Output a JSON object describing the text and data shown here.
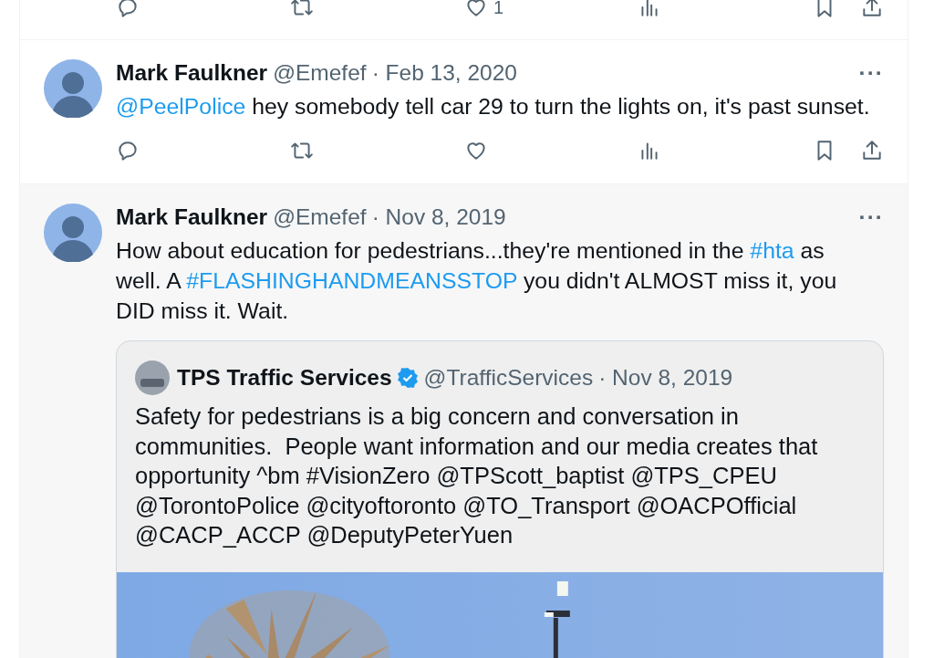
{
  "top_actions": [
    {
      "kind": "reply"
    },
    {
      "kind": "retweet"
    },
    {
      "kind": "like",
      "count": "1"
    },
    {
      "kind": "views"
    },
    {
      "kind": "bookmark"
    },
    {
      "kind": "share"
    }
  ],
  "tweets": [
    {
      "color": "#ffffff",
      "name": "Mark Faulkner",
      "handle": "@Emefef",
      "date": "· Feb 13, 2020",
      "more": "···",
      "body": [
        {
          "kind": "mention",
          "text": "@PeelPolice"
        },
        {
          "kind": "plain",
          "text": " hey somebody tell car 29 to turn the lights on, it's past sunset."
        }
      ],
      "actions": [
        {
          "kind": "reply"
        },
        {
          "kind": "retweet"
        },
        {
          "kind": "like"
        },
        {
          "kind": "views"
        },
        {
          "kind": "bookmark"
        },
        {
          "kind": "share"
        }
      ]
    },
    {
      "color": "#f7f7f7",
      "name": "Mark Faulkner",
      "handle": "@Emefef",
      "date": "· Nov 8, 2019",
      "more": "···",
      "body": [
        {
          "kind": "plain",
          "text": "How about education for pedestrians...they're mentioned in the "
        },
        {
          "kind": "hashtag",
          "text": "#hta"
        },
        {
          "kind": "plain",
          "text": " as well. A "
        },
        {
          "kind": "hashtag",
          "text": "#FLASHINGHANDMEANSSTOP"
        },
        {
          "kind": "plain",
          "text": " you didn't ALMOST miss it, you DID miss it. Wait."
        }
      ],
      "quote": {
        "name": "TPS Traffic Services",
        "verified": true,
        "handle": "@TrafficServices",
        "date": "· Nov 8, 2019",
        "text": "Safety for pedestrians is a big concern and conversation in communities.  People want information and our media creates that opportunity ^bm #VisionZero @TPScott_baptist @TPS_CPEU @TorontoPolice @cityoftoronto @TO_Transport @OACPOfficial @CACP_ACCP @DeputyPeterYuen"
      }
    }
  ]
}
